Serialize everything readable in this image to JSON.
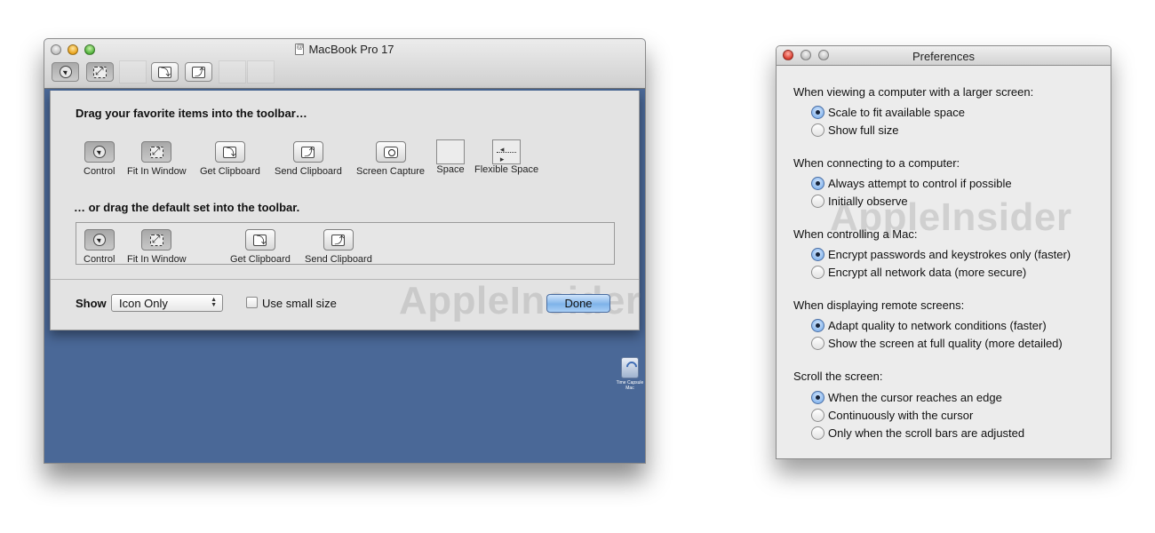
{
  "left_window": {
    "title": "MacBook Pro 17",
    "sheet": {
      "heading_drag": "Drag your favorite items into the toolbar…",
      "items": [
        {
          "label": "Control",
          "icon": "control-icon"
        },
        {
          "label": "Fit In Window",
          "icon": "fit-in-window-icon"
        },
        {
          "label": "Get Clipboard",
          "icon": "get-clipboard-icon"
        },
        {
          "label": "Send Clipboard",
          "icon": "send-clipboard-icon"
        },
        {
          "label": "Screen Capture",
          "icon": "screen-capture-icon"
        },
        {
          "label": "Space",
          "icon": "space-icon"
        },
        {
          "label": "Flexible Space",
          "icon": "flexible-space-icon"
        }
      ],
      "heading_default": "… or drag the default set into the toolbar.",
      "default_items": [
        {
          "label": "Control"
        },
        {
          "label": "Fit In Window"
        },
        {
          "label": "Get Clipboard"
        },
        {
          "label": "Send Clipboard"
        }
      ],
      "show_label": "Show",
      "show_value": "Icon Only",
      "small_size_label": "Use small size",
      "done_label": "Done"
    },
    "watermark": "AppleInsider",
    "desktop_icon_caption": "Time Capsule Mac"
  },
  "right_window": {
    "title": "Preferences",
    "watermark": "AppleInsider",
    "sections": [
      {
        "title": "When viewing a computer with a larger screen:",
        "options": [
          {
            "label": "Scale to fit available space",
            "selected": true
          },
          {
            "label": "Show full size",
            "selected": false
          }
        ]
      },
      {
        "title": "When connecting to a computer:",
        "options": [
          {
            "label": "Always attempt to control if possible",
            "selected": true
          },
          {
            "label": "Initially observe",
            "selected": false
          }
        ]
      },
      {
        "title": "When controlling a Mac:",
        "options": [
          {
            "label": "Encrypt passwords and keystrokes only (faster)",
            "selected": true
          },
          {
            "label": "Encrypt all network data (more secure)",
            "selected": false
          }
        ]
      },
      {
        "title": "When displaying remote screens:",
        "options": [
          {
            "label": "Adapt quality to network conditions (faster)",
            "selected": true
          },
          {
            "label": "Show the screen at full quality (more detailed)",
            "selected": false
          }
        ]
      },
      {
        "title": "Scroll the screen:",
        "options": [
          {
            "label": "When the cursor reaches an edge",
            "selected": true
          },
          {
            "label": "Continuously with the cursor",
            "selected": false
          },
          {
            "label": "Only when the scroll bars are adjusted",
            "selected": false
          }
        ]
      }
    ]
  }
}
